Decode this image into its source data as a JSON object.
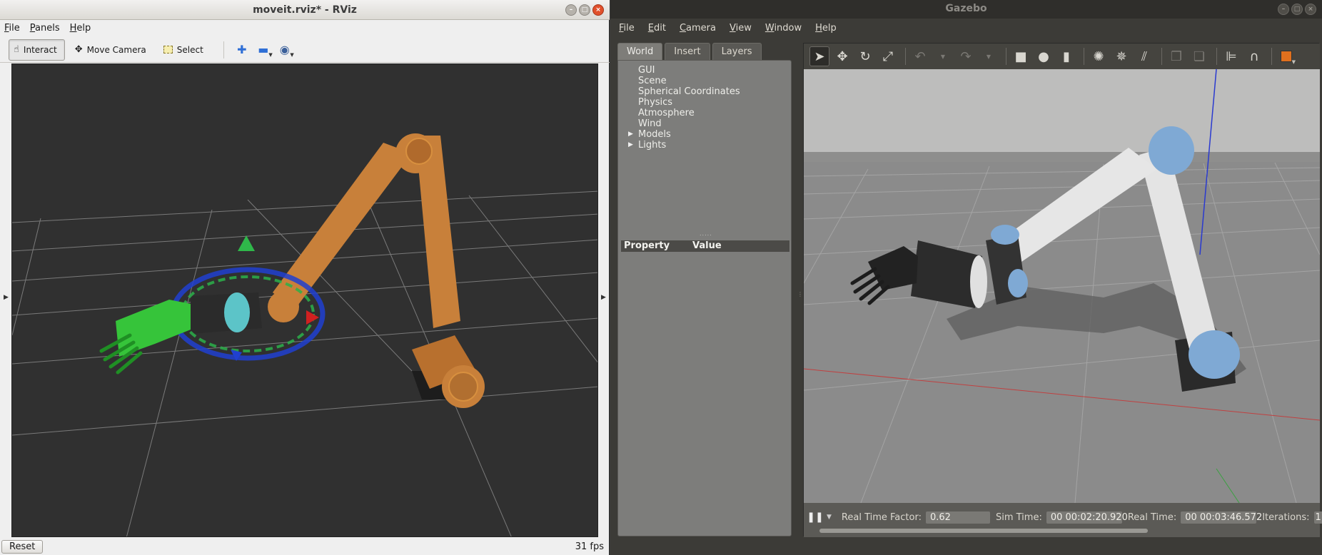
{
  "rviz": {
    "title": "moveit.rviz* - RViz",
    "menu": [
      "File",
      "Panels",
      "Help"
    ],
    "tools": {
      "interact": "Interact",
      "move_camera": "Move Camera",
      "select": "Select"
    },
    "footer": {
      "reset_label": "Reset",
      "fps": "31 fps"
    }
  },
  "gazebo": {
    "title": "Gazebo",
    "menu": [
      "File",
      "Edit",
      "Camera",
      "View",
      "Window",
      "Help"
    ],
    "tabs": [
      "World",
      "Insert",
      "Layers"
    ],
    "tree_items": [
      "GUI",
      "Scene",
      "Spherical Coordinates",
      "Physics",
      "Atmosphere",
      "Wind",
      "Models",
      "Lights"
    ],
    "property_header": {
      "property": "Property",
      "value": "Value"
    },
    "status": {
      "rtf_label": "Real Time Factor:",
      "rtf_value": "0.62",
      "sim_time_label": "Sim Time:",
      "sim_time_value": "00 00:02:20.920",
      "real_time_label": "Real Time:",
      "real_time_value": "00 00:03:46.572",
      "iterations_label": "Iterations:",
      "iterations_value": "1"
    }
  },
  "colors": {
    "rviz_robot": "#c8803a",
    "rviz_hand": "#33cc33",
    "gazebo_robot": "#e4e4e4",
    "gazebo_joint_cap": "#7fa9d4"
  }
}
